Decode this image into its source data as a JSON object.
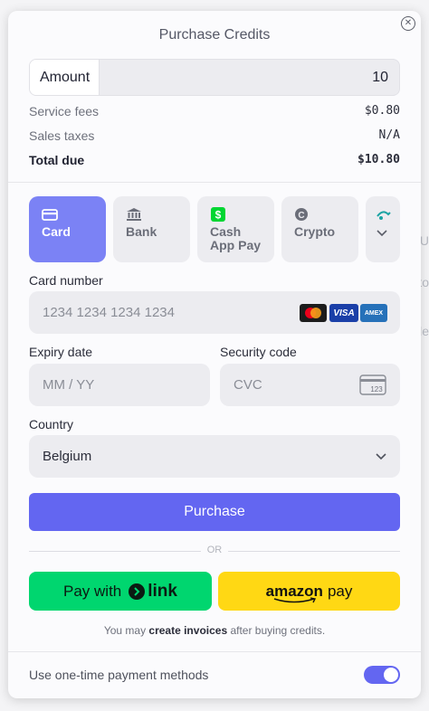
{
  "modal": {
    "title": "Purchase Credits",
    "close_icon": "close-icon"
  },
  "amount": {
    "label": "Amount",
    "value": "10"
  },
  "fees": [
    {
      "label": "Service fees",
      "value": "$0.80"
    },
    {
      "label": "Sales taxes",
      "value": "N/A"
    },
    {
      "label": "Total due",
      "value": "$10.80"
    }
  ],
  "methods": [
    {
      "label": "Card",
      "icon": "card-icon",
      "active": true
    },
    {
      "label": "Bank",
      "icon": "bank-icon",
      "active": false
    },
    {
      "label": "Cash App Pay",
      "line1": "Cash",
      "line2": "App Pay",
      "icon": "cash-app-icon",
      "active": false
    },
    {
      "label": "Crypto",
      "icon": "crypto-icon",
      "active": false
    },
    {
      "label": "",
      "icon": "chevron-down-icon",
      "active": false
    }
  ],
  "card": {
    "number_label": "Card number",
    "number_placeholder": "1234 1234 1234 1234",
    "brands": [
      "mastercard-icon",
      "visa-icon",
      "amex-icon"
    ],
    "brand_text": {
      "visa": "VISA",
      "amex": "AMEX"
    },
    "expiry_label": "Expiry date",
    "expiry_placeholder": "MM / YY",
    "cvc_label": "Security code",
    "cvc_placeholder": "CVC",
    "cvc_icon_text": "123"
  },
  "country": {
    "label": "Country",
    "value": "Belgium"
  },
  "purchase_label": "Purchase",
  "or_text": "OR",
  "link_button": {
    "prefix": "Pay with",
    "brand": "link"
  },
  "amazon_button": {
    "brand": "amazon",
    "suffix": "pay"
  },
  "note": {
    "before": "You may ",
    "bold": "create invoices",
    "after": " after buying credits."
  },
  "toggle": {
    "label": "Use one-time payment methods",
    "on": true
  },
  "colors": {
    "accent": "#6366f1",
    "active_tab": "#7b82f5",
    "link_green": "#00d66f",
    "amazon_yellow": "#ffd814"
  },
  "background": {
    "letters": [
      "U",
      "to",
      "de"
    ]
  }
}
